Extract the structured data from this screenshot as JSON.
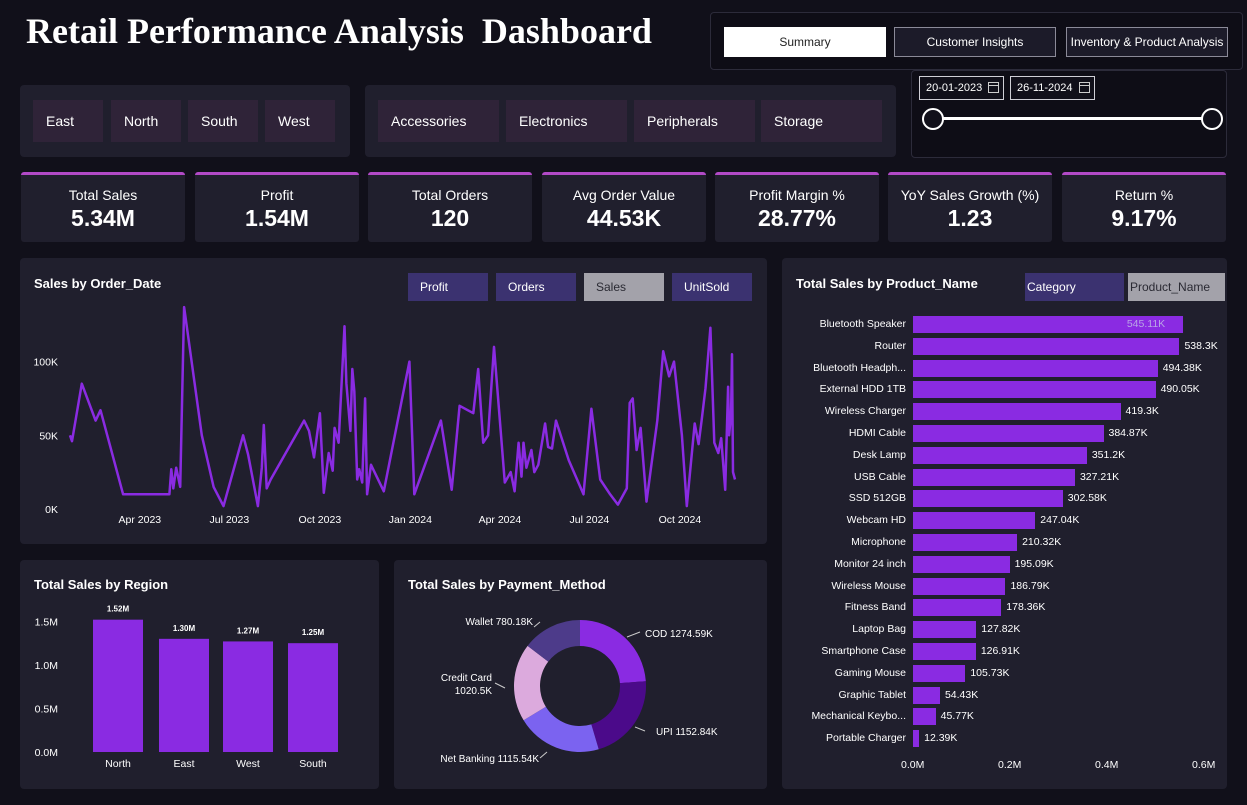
{
  "header": {
    "title": "Retail Performance Analysis  Dashboard"
  },
  "nav": {
    "tabs": [
      {
        "label": "Summary"
      },
      {
        "label": "Customer Insights"
      },
      {
        "label": "Inventory & Product Analysis"
      }
    ],
    "active": "Summary"
  },
  "filters": {
    "regions": [
      "East",
      "North",
      "South",
      "West"
    ],
    "categories": [
      "Accessories",
      "Electronics",
      "Peripherals",
      "Storage"
    ],
    "date_start": "20-01-2023",
    "date_end": "26-11-2024"
  },
  "kpis": [
    {
      "label": "Total Sales",
      "value": "5.34M"
    },
    {
      "label": "Profit",
      "value": "1.54M"
    },
    {
      "label": "Total Orders",
      "value": "120"
    },
    {
      "label": "Avg Order Value",
      "value": "44.53K"
    },
    {
      "label": "Profit Margin %",
      "value": "28.77%"
    },
    {
      "label": "YoY Sales Growth (%)",
      "value": "1.23"
    },
    {
      "label": "Return %",
      "value": "9.17%"
    }
  ],
  "sales_chart": {
    "title": "Sales by Order_Date",
    "toggles": [
      "Profit",
      "Orders",
      "Sales",
      "UnitSold"
    ],
    "active_toggle": "Sales"
  },
  "product_chart": {
    "title": "Total Sales by Product_Name",
    "toggles": [
      "Category",
      "Product_Name"
    ],
    "active_toggle": "Product_Name"
  },
  "region_chart": {
    "title": "Total Sales by Region"
  },
  "payment_chart": {
    "title": "Total Sales by Payment_Method"
  },
  "colors": {
    "accent": "#8a2be2",
    "panel": "#201f2d",
    "background": "#11101a",
    "kpi_border": "#b24ac7"
  },
  "chart_data": [
    {
      "type": "line",
      "title": "Sales by Order_Date",
      "x_ticks": [
        "Apr 2023",
        "Jul 2023",
        "Oct 2023",
        "Jan 2024",
        "Apr 2024",
        "Jul 2024",
        "Oct 2024"
      ],
      "y_ticks": [
        "0K",
        "50K",
        "100K"
      ],
      "ylim": [
        0,
        135000
      ],
      "x_range": [
        "2023-01-20",
        "2024-11-26"
      ],
      "points": [
        [
          "2023-01-20",
          50000
        ],
        [
          "2023-01-22",
          46000
        ],
        [
          "2023-02-01",
          85000
        ],
        [
          "2023-02-15",
          60000
        ],
        [
          "2023-02-20",
          67000
        ],
        [
          "2023-03-15",
          10000
        ],
        [
          "2023-04-20",
          10000
        ],
        [
          "2023-05-01",
          10000
        ],
        [
          "2023-05-03",
          27000
        ],
        [
          "2023-05-05",
          14000
        ],
        [
          "2023-05-08",
          28000
        ],
        [
          "2023-05-12",
          15000
        ],
        [
          "2023-05-16",
          137000
        ],
        [
          "2023-06-03",
          50000
        ],
        [
          "2023-06-15",
          15000
        ],
        [
          "2023-06-25",
          2000
        ],
        [
          "2023-07-15",
          50000
        ],
        [
          "2023-07-20",
          37000
        ],
        [
          "2023-07-30",
          2000
        ],
        [
          "2023-08-03",
          28000
        ],
        [
          "2023-08-05",
          57000
        ],
        [
          "2023-08-08",
          14000
        ],
        [
          "2023-08-12",
          20000
        ],
        [
          "2023-09-15",
          60000
        ],
        [
          "2023-09-20",
          53000
        ],
        [
          "2023-09-25",
          35000
        ],
        [
          "2023-10-01",
          65000
        ],
        [
          "2023-10-05",
          11000
        ],
        [
          "2023-10-10",
          38000
        ],
        [
          "2023-10-14",
          26000
        ],
        [
          "2023-10-16",
          55000
        ],
        [
          "2023-10-20",
          45000
        ],
        [
          "2023-10-26",
          124000
        ],
        [
          "2023-10-28",
          85000
        ],
        [
          "2023-11-01",
          53000
        ],
        [
          "2023-11-03",
          95000
        ],
        [
          "2023-11-05",
          80000
        ],
        [
          "2023-11-08",
          20000
        ],
        [
          "2023-11-10",
          27000
        ],
        [
          "2023-11-13",
          18000
        ],
        [
          "2023-11-16",
          75000
        ],
        [
          "2023-11-18",
          10000
        ],
        [
          "2023-11-22",
          30000
        ],
        [
          "2023-12-05",
          12000
        ],
        [
          "2023-12-31",
          100000
        ],
        [
          "2024-01-05",
          10000
        ],
        [
          "2024-02-01",
          60000
        ],
        [
          "2024-02-12",
          13000
        ],
        [
          "2024-02-20",
          70000
        ],
        [
          "2024-03-05",
          65000
        ],
        [
          "2024-03-10",
          95000
        ],
        [
          "2024-03-15",
          45000
        ],
        [
          "2024-03-20",
          50000
        ],
        [
          "2024-03-26",
          110000
        ],
        [
          "2024-04-06",
          18000
        ],
        [
          "2024-04-12",
          25000
        ],
        [
          "2024-04-16",
          12000
        ],
        [
          "2024-04-20",
          45000
        ],
        [
          "2024-04-23",
          22000
        ],
        [
          "2024-04-25",
          45000
        ],
        [
          "2024-04-28",
          28000
        ],
        [
          "2024-05-03",
          40000
        ],
        [
          "2024-05-06",
          25000
        ],
        [
          "2024-05-10",
          30000
        ],
        [
          "2024-05-17",
          58000
        ],
        [
          "2024-05-20",
          42000
        ],
        [
          "2024-05-24",
          41000
        ],
        [
          "2024-05-28",
          60000
        ],
        [
          "2024-06-10",
          33000
        ],
        [
          "2024-06-25",
          10000
        ],
        [
          "2024-07-03",
          68000
        ],
        [
          "2024-07-12",
          20000
        ],
        [
          "2024-07-22",
          10000
        ],
        [
          "2024-07-30",
          3000
        ],
        [
          "2024-08-08",
          14000
        ],
        [
          "2024-08-11",
          72000
        ],
        [
          "2024-08-14",
          75000
        ],
        [
          "2024-08-18",
          40000
        ],
        [
          "2024-08-22",
          55000
        ],
        [
          "2024-08-28",
          5000
        ],
        [
          "2024-09-08",
          60000
        ],
        [
          "2024-09-14",
          107000
        ],
        [
          "2024-09-20",
          90000
        ],
        [
          "2024-09-25",
          100000
        ],
        [
          "2024-10-03",
          50000
        ],
        [
          "2024-10-08",
          2000
        ],
        [
          "2024-10-16",
          58000
        ],
        [
          "2024-10-20",
          44000
        ],
        [
          "2024-10-23",
          60000
        ],
        [
          "2024-10-27",
          82000
        ],
        [
          "2024-11-01",
          123000
        ],
        [
          "2024-11-05",
          45000
        ],
        [
          "2024-11-09",
          38000
        ],
        [
          "2024-11-12",
          48000
        ],
        [
          "2024-11-16",
          13000
        ],
        [
          "2024-11-19",
          83000
        ],
        [
          "2024-11-20",
          50000
        ],
        [
          "2024-11-22",
          65000
        ],
        [
          "2024-11-23",
          105000
        ],
        [
          "2024-11-24",
          25000
        ],
        [
          "2024-11-26",
          20000
        ]
      ]
    },
    {
      "type": "bar",
      "title": "Total Sales by Region",
      "categories": [
        "North",
        "East",
        "West",
        "South"
      ],
      "values": [
        1.52,
        1.3,
        1.27,
        1.25
      ],
      "labels": [
        "1.52M",
        "1.30M",
        "1.27M",
        "1.25M"
      ],
      "y_ticks": [
        "0.0M",
        "0.5M",
        "1.0M",
        "1.5M"
      ],
      "ylim": [
        0,
        1.7
      ]
    },
    {
      "type": "pie",
      "title": "Total Sales by Payment_Method",
      "slices": [
        {
          "name": "COD",
          "value": 1274.59,
          "label": "COD 1274.59K",
          "color": "#8a2be2"
        },
        {
          "name": "UPI",
          "value": 1152.84,
          "label": "UPI 1152.84K",
          "color": "#4b0a8a"
        },
        {
          "name": "Net Banking",
          "value": 1115.54,
          "label": "Net Banking 1115.54K",
          "color": "#7b63f0"
        },
        {
          "name": "Credit Card",
          "value": 1020.5,
          "label_line1": "Credit Card",
          "label_line2": "1020.5K",
          "color": "#dcaadd"
        },
        {
          "name": "Wallet",
          "value": 780.18,
          "label": "Wallet 780.18K",
          "color": "#4d3b8a"
        }
      ]
    },
    {
      "type": "bar",
      "orientation": "horizontal",
      "title": "Total Sales by Product_Name",
      "categories": [
        "Bluetooth Speaker",
        "Router",
        "Bluetooth Headph...",
        "External HDD 1TB",
        "Wireless Charger",
        "HDMI Cable",
        "Desk Lamp",
        "USB Cable",
        "SSD 512GB",
        "Webcam HD",
        "Microphone",
        "Monitor 24 inch",
        "Wireless Mouse",
        "Fitness Band",
        "Laptop Bag",
        "Smartphone Case",
        "Gaming Mouse",
        "Graphic Tablet",
        "Mechanical Keybo...",
        "Portable Charger"
      ],
      "values": [
        545.11,
        538.3,
        494.38,
        490.05,
        419.3,
        384.87,
        351.2,
        327.21,
        302.58,
        247.04,
        210.32,
        195.09,
        186.79,
        178.36,
        127.82,
        126.91,
        105.73,
        54.43,
        45.77,
        12.39
      ],
      "labels": [
        "545.11K",
        "538.3K",
        "494.38K",
        "490.05K",
        "419.3K",
        "384.87K",
        "351.2K",
        "327.21K",
        "302.58K",
        "247.04K",
        "210.32K",
        "195.09K",
        "186.79K",
        "178.36K",
        "127.82K",
        "126.91K",
        "105.73K",
        "54.43K",
        "45.77K",
        "12.39K"
      ],
      "x_ticks": [
        "0.0M",
        "0.2M",
        "0.4M",
        "0.6M"
      ],
      "xlim": [
        0,
        0.6
      ]
    }
  ]
}
